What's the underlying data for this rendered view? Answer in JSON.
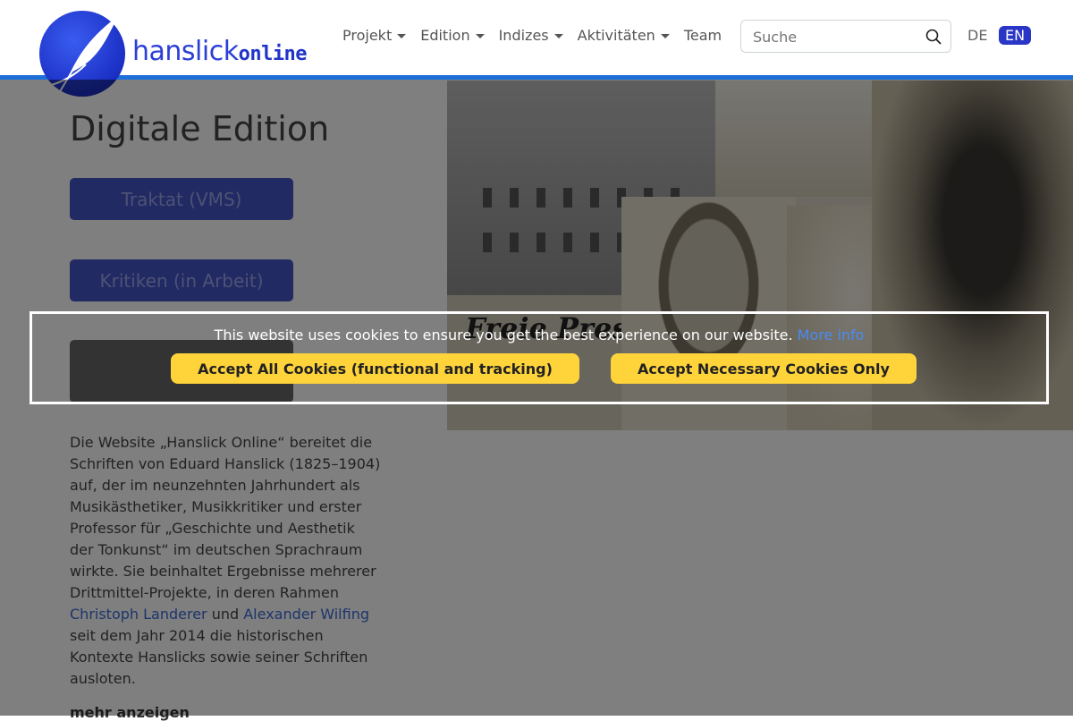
{
  "brand": {
    "logo_text_main": "hanslick",
    "logo_text_suffix": "online"
  },
  "nav": {
    "items": [
      {
        "label": "Projekt",
        "has_dropdown": true
      },
      {
        "label": "Edition",
        "has_dropdown": true
      },
      {
        "label": "Indizes",
        "has_dropdown": true
      },
      {
        "label": "Aktivitäten",
        "has_dropdown": true
      },
      {
        "label": "Team",
        "has_dropdown": false
      }
    ],
    "search": {
      "placeholder": "Suche",
      "value": ""
    },
    "languages": {
      "de": "DE",
      "en": "EN",
      "active": "EN"
    }
  },
  "main": {
    "title": "Digitale Edition",
    "buttons": {
      "traktat": "Traktat (VMS)",
      "kritiken": "Kritiken (in Arbeit)"
    },
    "intro": {
      "text_before": "Die Website „Hanslick Online“ bereitet die Schriften von Eduard Hanslick (1825–1904) auf, der im neunzehnten Jahrhundert als Musikästhetiker, Musikkritiker und erster Professor für „Geschichte und Aesthetik der Tonkunst“ im deutschen Sprachraum wirkte. Sie beinhaltet Ergebnisse mehrerer Drittmittel-Projekte, in deren Rahmen ",
      "link1": "Christoph Landerer",
      "text_middle": " und ",
      "link2": "Alexander Wilfing",
      "text_after": " seit dem Jahr 2014 die historischen Kontexte Hanslicks sowie seiner Schriften ausloten."
    },
    "more": "mehr anzeigen",
    "collage_text": "Freie Presse."
  },
  "cookie": {
    "message": "This website uses cookies to ensure you get the best experience on our website.",
    "more_info": "More info",
    "accept_all": "Accept All Cookies (functional and tracking)",
    "accept_necessary": "Accept Necessary Cookies Only"
  },
  "colors": {
    "accent": "#1e6fd9",
    "cookie_button": "#ffd43b",
    "brand_blue": "#2a36c6"
  }
}
